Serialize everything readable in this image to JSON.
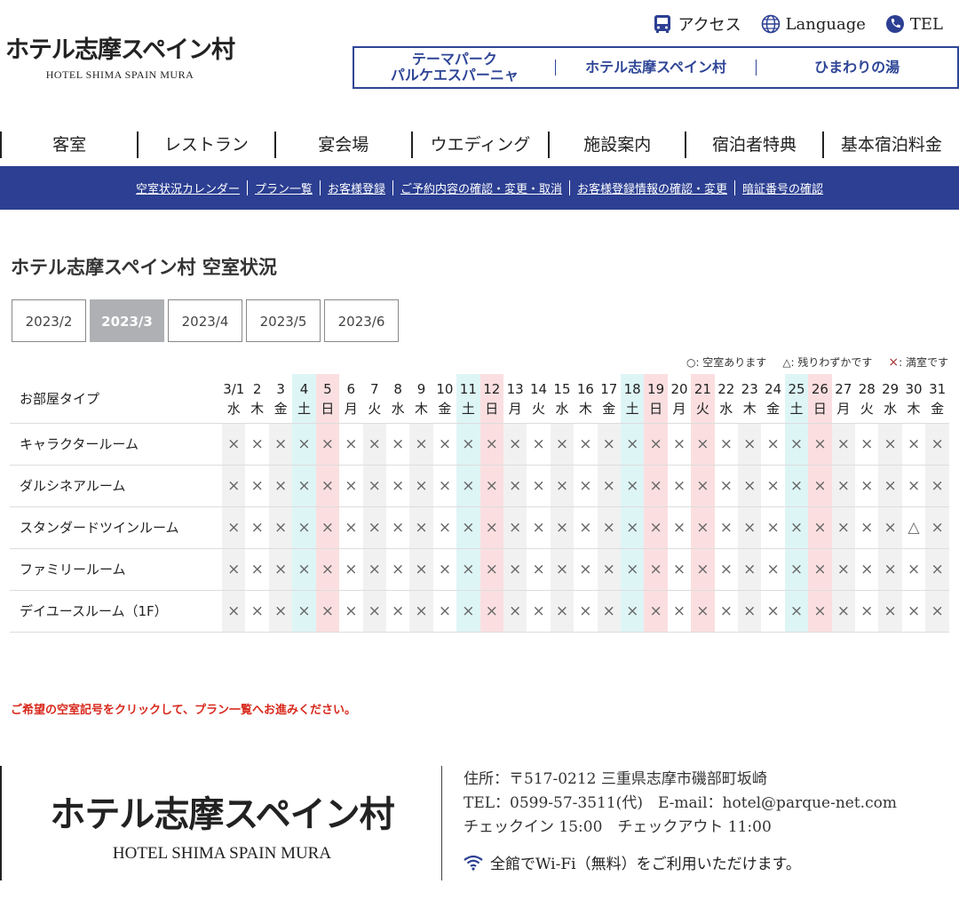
{
  "header": {
    "logo_jp": "ホテル志摩スペイン村",
    "logo_en": "HOTEL SHIMA SPAIN MURA",
    "toplinks": [
      {
        "label": "アクセス",
        "icon": "bus-icon"
      },
      {
        "label": "Language",
        "icon": "globe-icon"
      },
      {
        "label": "TEL",
        "icon": "phone-icon"
      }
    ],
    "subnav": [
      {
        "line1": "テーマパーク",
        "line2": "パルケエスパーニャ"
      },
      {
        "line1": "ホテル志摩スペイン村",
        "line2": ""
      },
      {
        "line1": "ひまわりの湯",
        "line2": ""
      }
    ],
    "brand_color": "#2c3f92"
  },
  "mainnav": [
    "客室",
    "レストラン",
    "宴会場",
    "ウエディング",
    "施設案内",
    "宿泊者特典",
    "基本宿泊料金"
  ],
  "bluebar": [
    "空室状況カレンダー",
    "プラン一覧",
    "お客様登録",
    "ご予約内容の確認・変更・取消",
    "お客様登録情報の確認・変更",
    "暗証番号の確認"
  ],
  "page_title": "ホテル志摩スペイン村 空室状況",
  "months": [
    {
      "label": "2023/2",
      "active": false
    },
    {
      "label": "2023/3",
      "active": true
    },
    {
      "label": "2023/4",
      "active": false
    },
    {
      "label": "2023/5",
      "active": false
    },
    {
      "label": "2023/6",
      "active": false
    }
  ],
  "legend": {
    "available": "○: 空室あります",
    "few": "△: 残りわずかです",
    "full_mark": "×",
    "full": ": 満室です"
  },
  "table": {
    "room_type_header": "お部屋タイプ",
    "days": [
      {
        "d": "3/1",
        "w": "水",
        "t": "wd"
      },
      {
        "d": "2",
        "w": "木",
        "t": "wd"
      },
      {
        "d": "3",
        "w": "金",
        "t": "wd"
      },
      {
        "d": "4",
        "w": "土",
        "t": "sat"
      },
      {
        "d": "5",
        "w": "日",
        "t": "sun"
      },
      {
        "d": "6",
        "w": "月",
        "t": "wd"
      },
      {
        "d": "7",
        "w": "火",
        "t": "wd"
      },
      {
        "d": "8",
        "w": "水",
        "t": "wd"
      },
      {
        "d": "9",
        "w": "木",
        "t": "wd"
      },
      {
        "d": "10",
        "w": "金",
        "t": "wd"
      },
      {
        "d": "11",
        "w": "土",
        "t": "sat"
      },
      {
        "d": "12",
        "w": "日",
        "t": "sun"
      },
      {
        "d": "13",
        "w": "月",
        "t": "wd"
      },
      {
        "d": "14",
        "w": "火",
        "t": "wd"
      },
      {
        "d": "15",
        "w": "水",
        "t": "wd"
      },
      {
        "d": "16",
        "w": "木",
        "t": "wd"
      },
      {
        "d": "17",
        "w": "金",
        "t": "wd"
      },
      {
        "d": "18",
        "w": "土",
        "t": "sat"
      },
      {
        "d": "19",
        "w": "日",
        "t": "sun"
      },
      {
        "d": "20",
        "w": "月",
        "t": "wd"
      },
      {
        "d": "21",
        "w": "火",
        "t": "sun"
      },
      {
        "d": "22",
        "w": "水",
        "t": "wd"
      },
      {
        "d": "23",
        "w": "木",
        "t": "wd"
      },
      {
        "d": "24",
        "w": "金",
        "t": "wd"
      },
      {
        "d": "25",
        "w": "土",
        "t": "sat"
      },
      {
        "d": "26",
        "w": "日",
        "t": "sun"
      },
      {
        "d": "27",
        "w": "月",
        "t": "wd"
      },
      {
        "d": "28",
        "w": "火",
        "t": "wd"
      },
      {
        "d": "29",
        "w": "水",
        "t": "wd"
      },
      {
        "d": "30",
        "w": "木",
        "t": "wd"
      },
      {
        "d": "31",
        "w": "金",
        "t": "wd"
      }
    ],
    "rooms": [
      {
        "name": "キャラクタールーム",
        "cells": "×××××××××××××××××××××××××××××××"
      },
      {
        "name": "ダルシネアルーム",
        "cells": "×××××××××××××××××××××××××××××××"
      },
      {
        "name": "スタンダードツインルーム",
        "cells": "×××××××××××××××××××××××××××××△×"
      },
      {
        "name": "ファミリールーム",
        "cells": "×××××××××××××××××××××××××××××××"
      },
      {
        "name": "デイユースルーム（1F）",
        "cells": "×××××××××××××××××××××××××××××××"
      }
    ]
  },
  "notice": "ご希望の空室記号をクリックして、プラン一覧へお進みください。",
  "footer": {
    "logo_jp": "ホテル志摩スペイン村",
    "logo_en": "HOTEL SHIMA SPAIN MURA",
    "address": "住所：〒517-0212 三重県志摩市磯部町坂崎",
    "tel": "TEL：0599-57-3511(代)　E-mail：hotel@parque-net.com",
    "checkin": "チェックイン 15:00　チェックアウト 11:00",
    "wifi": "全館でWi-Fi（無料）をご利用いただけます。"
  }
}
